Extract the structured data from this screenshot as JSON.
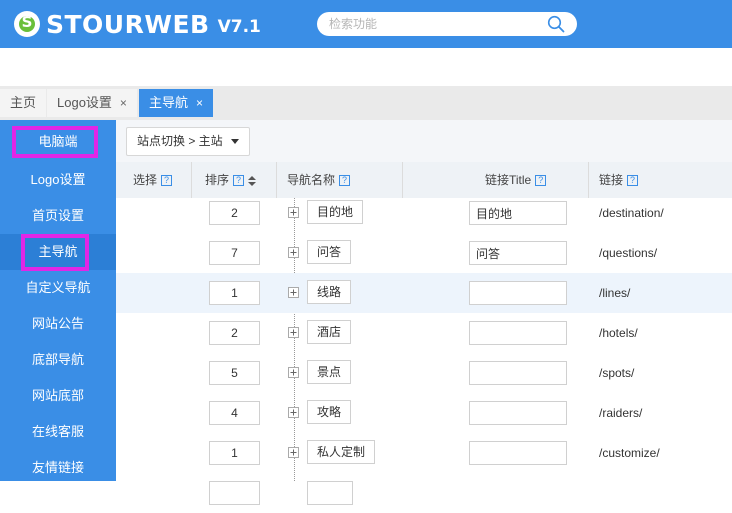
{
  "header": {
    "logo_text": "STOURWEB",
    "version": "V7.1",
    "search_placeholder": "检索功能"
  },
  "tabs": [
    {
      "label": "主页",
      "closable": false,
      "active": false
    },
    {
      "label": "Logo设置",
      "closable": true,
      "active": false
    },
    {
      "label": "主导航",
      "closable": true,
      "active": true
    }
  ],
  "tab_close_glyph": "×",
  "sidebar": {
    "items": [
      {
        "label": "电脑端"
      },
      {
        "label": "Logo设置"
      },
      {
        "label": "首页设置"
      },
      {
        "label": "主导航"
      },
      {
        "label": "自定义导航"
      },
      {
        "label": "网站公告"
      },
      {
        "label": "底部导航"
      },
      {
        "label": "网站底部"
      },
      {
        "label": "在线客服"
      },
      {
        "label": "友情链接"
      }
    ]
  },
  "toolbar": {
    "site_switch_label": "站点切换 > 主站"
  },
  "table": {
    "help_glyph": "?",
    "columns": [
      {
        "label": "选择"
      },
      {
        "label": "排序"
      },
      {
        "label": "导航名称"
      },
      {
        "label": "链接Title"
      },
      {
        "label": "链接"
      }
    ],
    "rows": [
      {
        "sort": "2",
        "name": "目的地",
        "title": "目的地",
        "link": "/destination/"
      },
      {
        "sort": "7",
        "name": "问答",
        "title": "问答",
        "link": "/questions/"
      },
      {
        "sort": "1",
        "name": "线路",
        "title": "",
        "link": "/lines/"
      },
      {
        "sort": "2",
        "name": "酒店",
        "title": "",
        "link": "/hotels/"
      },
      {
        "sort": "5",
        "name": "景点",
        "title": "",
        "link": "/spots/"
      },
      {
        "sort": "4",
        "name": "攻略",
        "title": "",
        "link": "/raiders/"
      },
      {
        "sort": "1",
        "name": "私人定制",
        "title": "",
        "link": "/customize/"
      }
    ]
  },
  "colors": {
    "brand_blue": "#3a8ee6",
    "highlight_magenta": "#e126e6"
  }
}
